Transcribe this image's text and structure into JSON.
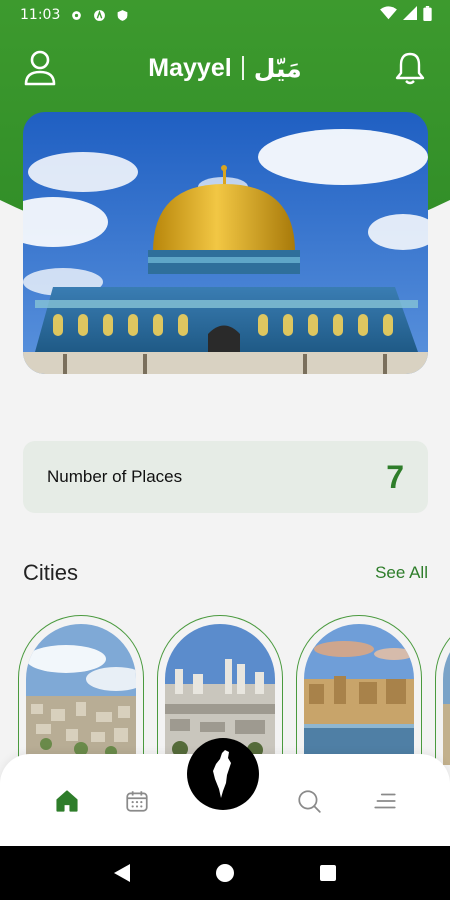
{
  "status_bar": {
    "time": "11:03",
    "icons": [
      "settings-icon",
      "shield-a-icon",
      "shield-icon",
      "wifi-icon",
      "signal-icon",
      "battery-icon"
    ]
  },
  "header": {
    "brand_en": "Mayyel",
    "brand_ar": "مَيّل",
    "profile_icon": "user-icon",
    "notification_icon": "bell-icon"
  },
  "hero": {
    "image": "dome-of-the-rock-photo"
  },
  "stats": {
    "label": "Number of Places",
    "value": "7"
  },
  "cities": {
    "title": "Cities",
    "see_all": "See All",
    "items": [
      {
        "image": "city-aerial-photo-1"
      },
      {
        "image": "city-skyline-photo-2"
      },
      {
        "image": "old-city-sea-photo-3"
      },
      {
        "image": "city-photo-4"
      }
    ]
  },
  "bottom_nav": {
    "items": [
      "home-icon",
      "calendar-icon",
      "map-icon",
      "search-icon",
      "menu-icon"
    ],
    "active": "home"
  },
  "colors": {
    "brand_green": "#3d9a2e",
    "accent_green": "#2e7d2a",
    "card_bg": "#e6ece6"
  },
  "system_nav": [
    "back-icon",
    "home-circle-icon",
    "recents-icon"
  ]
}
